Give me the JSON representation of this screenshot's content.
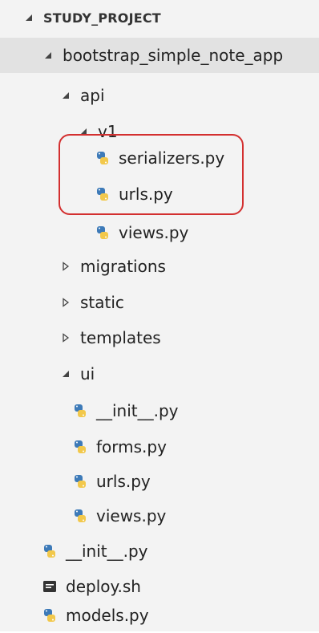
{
  "explorer": {
    "section_title": "STUDY_PROJECT",
    "items": [
      {
        "label": "bootstrap_simple_note_app",
        "kind": "folder",
        "expanded": true,
        "name": "tree-folder-bootstrap-simple-note-app"
      },
      {
        "label": "api",
        "kind": "folder",
        "expanded": true,
        "name": "tree-folder-api"
      },
      {
        "label": "v1",
        "kind": "folder",
        "expanded": true,
        "name": "tree-folder-v1"
      },
      {
        "label": "serializers.py",
        "kind": "python",
        "name": "tree-file-serializers-py"
      },
      {
        "label": "urls.py",
        "kind": "python",
        "name": "tree-file-api-urls-py"
      },
      {
        "label": "views.py",
        "kind": "python",
        "name": "tree-file-api-views-py"
      },
      {
        "label": "migrations",
        "kind": "folder",
        "expanded": false,
        "name": "tree-folder-migrations"
      },
      {
        "label": "static",
        "kind": "folder",
        "expanded": false,
        "name": "tree-folder-static"
      },
      {
        "label": "templates",
        "kind": "folder",
        "expanded": false,
        "name": "tree-folder-templates"
      },
      {
        "label": "ui",
        "kind": "folder",
        "expanded": true,
        "name": "tree-folder-ui"
      },
      {
        "label": "__init__.py",
        "kind": "python",
        "name": "tree-file-ui-init-py"
      },
      {
        "label": "forms.py",
        "kind": "python",
        "name": "tree-file-forms-py"
      },
      {
        "label": "urls.py",
        "kind": "python",
        "name": "tree-file-ui-urls-py"
      },
      {
        "label": "views.py",
        "kind": "python",
        "name": "tree-file-ui-views-py"
      },
      {
        "label": "__init__.py",
        "kind": "python",
        "name": "tree-file-app-init-py"
      },
      {
        "label": "deploy.sh",
        "kind": "shell",
        "name": "tree-file-deploy-sh"
      },
      {
        "label": "models.py",
        "kind": "python",
        "name": "tree-file-models-py"
      }
    ]
  },
  "colors": {
    "panel_bg": "#f3f3f3",
    "selected_bg": "#e2e2e2",
    "python_blue": "#3d7ab8",
    "python_yellow": "#f2c84b",
    "highlight_border": "#d32f2f"
  }
}
